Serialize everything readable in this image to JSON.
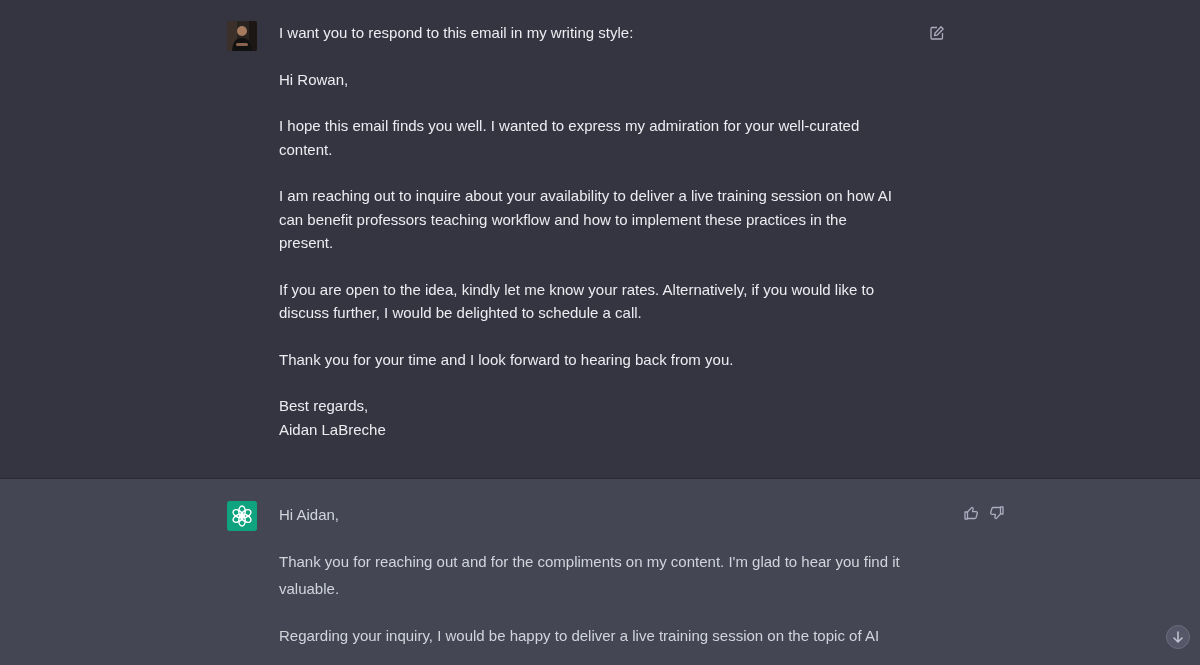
{
  "messages": [
    {
      "kind": "user",
      "toolbar": {
        "kind": "edit"
      },
      "paragraphs": [
        "I want you to respond to this email in my writing style:",
        "Hi Rowan,",
        "I hope this email finds you well. I wanted to express my admiration for your well-curated content.",
        "I am reaching out to inquire about your availability to deliver a live training session on how AI can benefit professors teaching workflow and how to implement these practices in the present.",
        "If you are open to the idea, kindly let me know your rates. Alternatively, if you would like to discuss further, I would be delighted to schedule a call.",
        "Thank you for your time and I look forward to hearing back from you.",
        "Best regards,\nAidan LaBreche"
      ]
    },
    {
      "kind": "assistant",
      "avatar": {
        "kind": "logo"
      },
      "toolbar": {
        "kind": "feedback"
      },
      "paragraphs": [
        "Hi Aidan,",
        "Thank you for reaching out and for the compliments on my content. I'm glad to hear you find it valuable.",
        "Regarding your inquiry, I would be happy to deliver a live training session on the topic of AI"
      ]
    }
  ]
}
